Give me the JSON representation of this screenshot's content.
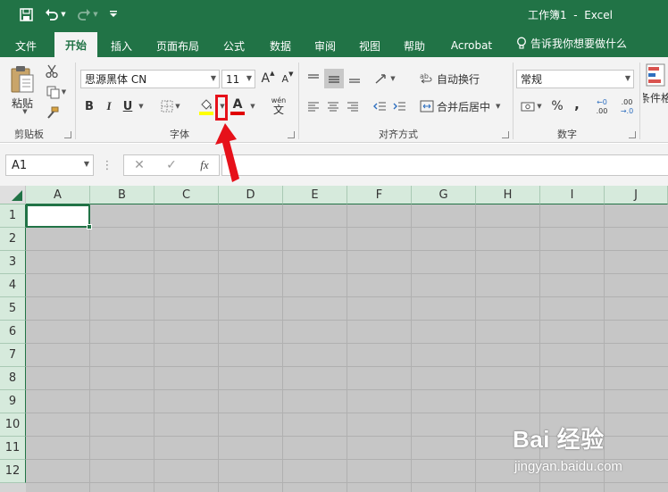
{
  "app": {
    "doc_title": "工作簿1  -  Excel"
  },
  "tabs": [
    {
      "label": "文件"
    },
    {
      "label": "开始"
    },
    {
      "label": "插入"
    },
    {
      "label": "页面布局"
    },
    {
      "label": "公式"
    },
    {
      "label": "数据"
    },
    {
      "label": "审阅"
    },
    {
      "label": "视图"
    },
    {
      "label": "帮助"
    },
    {
      "label": "Acrobat"
    }
  ],
  "tell_me": "告诉我你想要做什么",
  "ribbon": {
    "paste_label": "粘贴",
    "clipboard_label": "剪贴板",
    "font_name": "思源黑体 CN",
    "font_size": "11",
    "font_group_label": "字体",
    "bold": "B",
    "italic": "I",
    "underline": "U",
    "font_color_letter": "A",
    "grow_font": "A",
    "shrink_font": "A",
    "phonetic": "wén",
    "phonetic_char": "文",
    "wrap_text": "自动换行",
    "merge_center": "合并后居中",
    "align_group_label": "对齐方式",
    "number_format": "常规",
    "percent": "%",
    "comma": ",",
    "inc_decimal_top": "←0",
    "inc_decimal_bottom": ".00",
    "dec_decimal_top": ".00",
    "dec_decimal_bottom": "→.0",
    "number_group_label": "数字",
    "conditional_label": "条件格"
  },
  "formula_bar": {
    "name_box": "A1",
    "cancel": "✕",
    "enter": "✓",
    "fx": "fx",
    "value": ""
  },
  "grid": {
    "columns": [
      "A",
      "B",
      "C",
      "D",
      "E",
      "F",
      "G",
      "H",
      "I",
      "J"
    ],
    "rows": [
      "1",
      "2",
      "3",
      "4",
      "5",
      "6",
      "7",
      "8",
      "9",
      "10",
      "11",
      "12"
    ]
  },
  "colors": {
    "accent": "#217346",
    "annotation": "#e6111a",
    "fill_yellow": "#ffff00",
    "font_red": "#e00000"
  },
  "watermark": {
    "logo": "Bai 经验",
    "url": "jingyan.baidu.com"
  }
}
